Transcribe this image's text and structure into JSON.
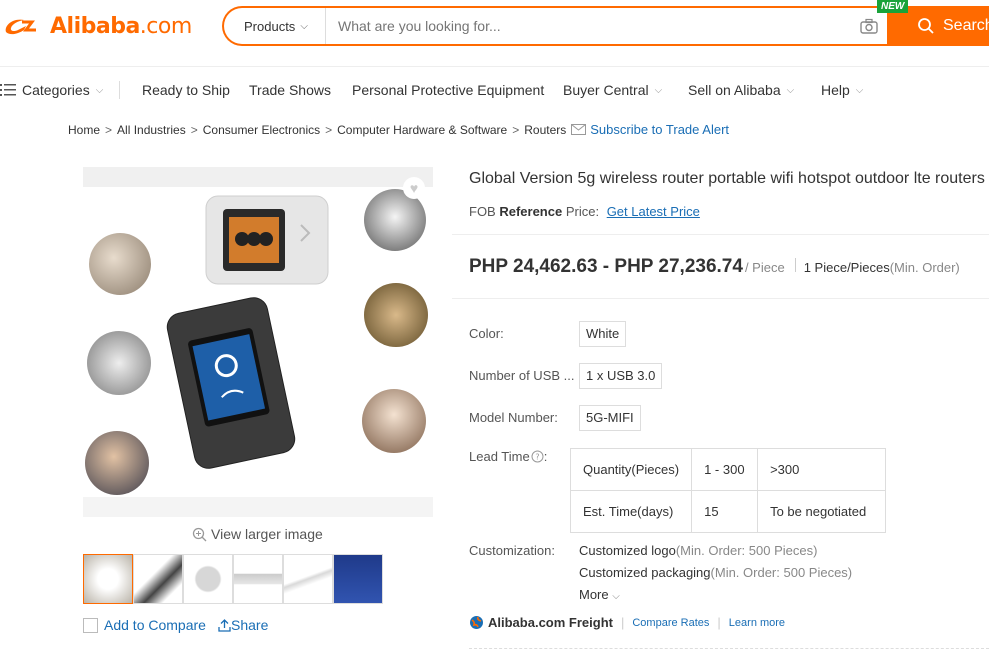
{
  "header": {
    "brand": "Alibaba",
    "tld": ".com",
    "search_category": "Products",
    "search_placeholder": "What are you looking for...",
    "search_button": "Search",
    "new_badge": "NEW",
    "accent_color": "#ff6a00"
  },
  "nav": {
    "items": [
      {
        "label": "Categories",
        "icon": "menu-icon",
        "dropdown": true
      },
      {
        "label": "Ready to Ship",
        "dropdown": false
      },
      {
        "label": "Trade Shows",
        "dropdown": false
      },
      {
        "label": "Personal Protective Equipment",
        "dropdown": false
      },
      {
        "label": "Buyer Central",
        "dropdown": true
      },
      {
        "label": "Sell on Alibaba",
        "dropdown": true
      },
      {
        "label": "Help",
        "dropdown": true
      }
    ]
  },
  "breadcrumb": {
    "items": [
      "Home",
      "All Industries",
      "Consumer Electronics",
      "Computer Hardware & Software",
      "Routers"
    ],
    "subscribe": "Subscribe to Trade Alert"
  },
  "gallery": {
    "view_larger": "View larger image",
    "thumb_count": 6,
    "add_to_compare": "Add to Compare",
    "share": "Share"
  },
  "product": {
    "title": "Global Version 5g wireless router portable wifi hotspot outdoor lte routers",
    "fob_prefix": "FOB ",
    "fob_bold": "Reference",
    "fob_suffix": " Price:",
    "fob_link": "Get Latest Price",
    "price_range": "PHP 24,462.63 - PHP 27,236.74",
    "price_unit": "/ Piece",
    "moq": "1 Piece/Pieces",
    "moq_note": "(Min. Order)",
    "attributes": [
      {
        "label": "Color:",
        "value": "White"
      },
      {
        "label": "Number of USB ...",
        "value": "1 x USB 3.0"
      },
      {
        "label": "Model Number:",
        "value": "5G-MIFI"
      }
    ],
    "lead_time_label": "Lead Time",
    "lead_table": {
      "row1": [
        "Quantity(Pieces)",
        "1 - 300",
        ">300"
      ],
      "row2": [
        "Est. Time(days)",
        "15",
        "To be negotiated"
      ]
    },
    "customization_label": "Customization:",
    "customization": [
      {
        "text": "Customized logo",
        "note": "(Min. Order: 500 Pieces)"
      },
      {
        "text": "Customized packaging",
        "note": "(Min. Order: 500 Pieces)"
      }
    ],
    "more": "More",
    "freight_name": "Alibaba.com Freight",
    "compare_rates": "Compare Rates",
    "learn_more": "Learn more"
  }
}
